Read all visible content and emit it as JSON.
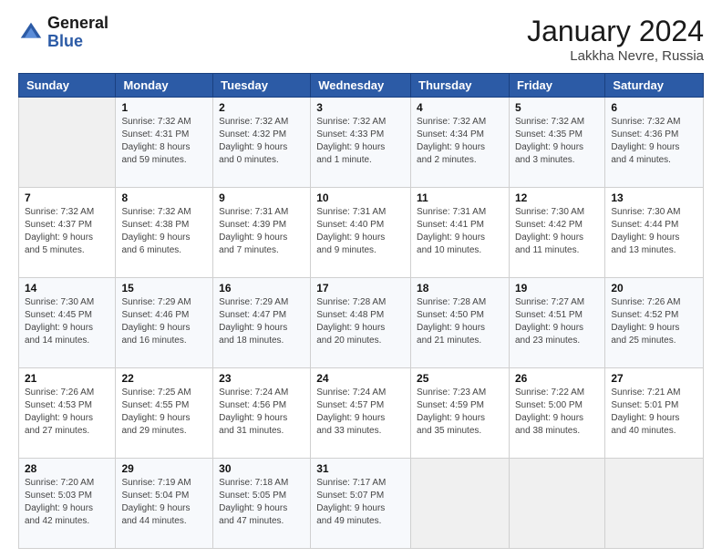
{
  "header": {
    "logo_general": "General",
    "logo_blue": "Blue",
    "month": "January 2024",
    "location": "Lakkha Nevre, Russia"
  },
  "days_of_week": [
    "Sunday",
    "Monday",
    "Tuesday",
    "Wednesday",
    "Thursday",
    "Friday",
    "Saturday"
  ],
  "weeks": [
    [
      {
        "day": "",
        "info": ""
      },
      {
        "day": "1",
        "info": "Sunrise: 7:32 AM\nSunset: 4:31 PM\nDaylight: 8 hours\nand 59 minutes."
      },
      {
        "day": "2",
        "info": "Sunrise: 7:32 AM\nSunset: 4:32 PM\nDaylight: 9 hours\nand 0 minutes."
      },
      {
        "day": "3",
        "info": "Sunrise: 7:32 AM\nSunset: 4:33 PM\nDaylight: 9 hours\nand 1 minute."
      },
      {
        "day": "4",
        "info": "Sunrise: 7:32 AM\nSunset: 4:34 PM\nDaylight: 9 hours\nand 2 minutes."
      },
      {
        "day": "5",
        "info": "Sunrise: 7:32 AM\nSunset: 4:35 PM\nDaylight: 9 hours\nand 3 minutes."
      },
      {
        "day": "6",
        "info": "Sunrise: 7:32 AM\nSunset: 4:36 PM\nDaylight: 9 hours\nand 4 minutes."
      }
    ],
    [
      {
        "day": "7",
        "info": "Sunrise: 7:32 AM\nSunset: 4:37 PM\nDaylight: 9 hours\nand 5 minutes."
      },
      {
        "day": "8",
        "info": "Sunrise: 7:32 AM\nSunset: 4:38 PM\nDaylight: 9 hours\nand 6 minutes."
      },
      {
        "day": "9",
        "info": "Sunrise: 7:31 AM\nSunset: 4:39 PM\nDaylight: 9 hours\nand 7 minutes."
      },
      {
        "day": "10",
        "info": "Sunrise: 7:31 AM\nSunset: 4:40 PM\nDaylight: 9 hours\nand 9 minutes."
      },
      {
        "day": "11",
        "info": "Sunrise: 7:31 AM\nSunset: 4:41 PM\nDaylight: 9 hours\nand 10 minutes."
      },
      {
        "day": "12",
        "info": "Sunrise: 7:30 AM\nSunset: 4:42 PM\nDaylight: 9 hours\nand 11 minutes."
      },
      {
        "day": "13",
        "info": "Sunrise: 7:30 AM\nSunset: 4:44 PM\nDaylight: 9 hours\nand 13 minutes."
      }
    ],
    [
      {
        "day": "14",
        "info": "Sunrise: 7:30 AM\nSunset: 4:45 PM\nDaylight: 9 hours\nand 14 minutes."
      },
      {
        "day": "15",
        "info": "Sunrise: 7:29 AM\nSunset: 4:46 PM\nDaylight: 9 hours\nand 16 minutes."
      },
      {
        "day": "16",
        "info": "Sunrise: 7:29 AM\nSunset: 4:47 PM\nDaylight: 9 hours\nand 18 minutes."
      },
      {
        "day": "17",
        "info": "Sunrise: 7:28 AM\nSunset: 4:48 PM\nDaylight: 9 hours\nand 20 minutes."
      },
      {
        "day": "18",
        "info": "Sunrise: 7:28 AM\nSunset: 4:50 PM\nDaylight: 9 hours\nand 21 minutes."
      },
      {
        "day": "19",
        "info": "Sunrise: 7:27 AM\nSunset: 4:51 PM\nDaylight: 9 hours\nand 23 minutes."
      },
      {
        "day": "20",
        "info": "Sunrise: 7:26 AM\nSunset: 4:52 PM\nDaylight: 9 hours\nand 25 minutes."
      }
    ],
    [
      {
        "day": "21",
        "info": "Sunrise: 7:26 AM\nSunset: 4:53 PM\nDaylight: 9 hours\nand 27 minutes."
      },
      {
        "day": "22",
        "info": "Sunrise: 7:25 AM\nSunset: 4:55 PM\nDaylight: 9 hours\nand 29 minutes."
      },
      {
        "day": "23",
        "info": "Sunrise: 7:24 AM\nSunset: 4:56 PM\nDaylight: 9 hours\nand 31 minutes."
      },
      {
        "day": "24",
        "info": "Sunrise: 7:24 AM\nSunset: 4:57 PM\nDaylight: 9 hours\nand 33 minutes."
      },
      {
        "day": "25",
        "info": "Sunrise: 7:23 AM\nSunset: 4:59 PM\nDaylight: 9 hours\nand 35 minutes."
      },
      {
        "day": "26",
        "info": "Sunrise: 7:22 AM\nSunset: 5:00 PM\nDaylight: 9 hours\nand 38 minutes."
      },
      {
        "day": "27",
        "info": "Sunrise: 7:21 AM\nSunset: 5:01 PM\nDaylight: 9 hours\nand 40 minutes."
      }
    ],
    [
      {
        "day": "28",
        "info": "Sunrise: 7:20 AM\nSunset: 5:03 PM\nDaylight: 9 hours\nand 42 minutes."
      },
      {
        "day": "29",
        "info": "Sunrise: 7:19 AM\nSunset: 5:04 PM\nDaylight: 9 hours\nand 44 minutes."
      },
      {
        "day": "30",
        "info": "Sunrise: 7:18 AM\nSunset: 5:05 PM\nDaylight: 9 hours\nand 47 minutes."
      },
      {
        "day": "31",
        "info": "Sunrise: 7:17 AM\nSunset: 5:07 PM\nDaylight: 9 hours\nand 49 minutes."
      },
      {
        "day": "",
        "info": ""
      },
      {
        "day": "",
        "info": ""
      },
      {
        "day": "",
        "info": ""
      }
    ]
  ]
}
